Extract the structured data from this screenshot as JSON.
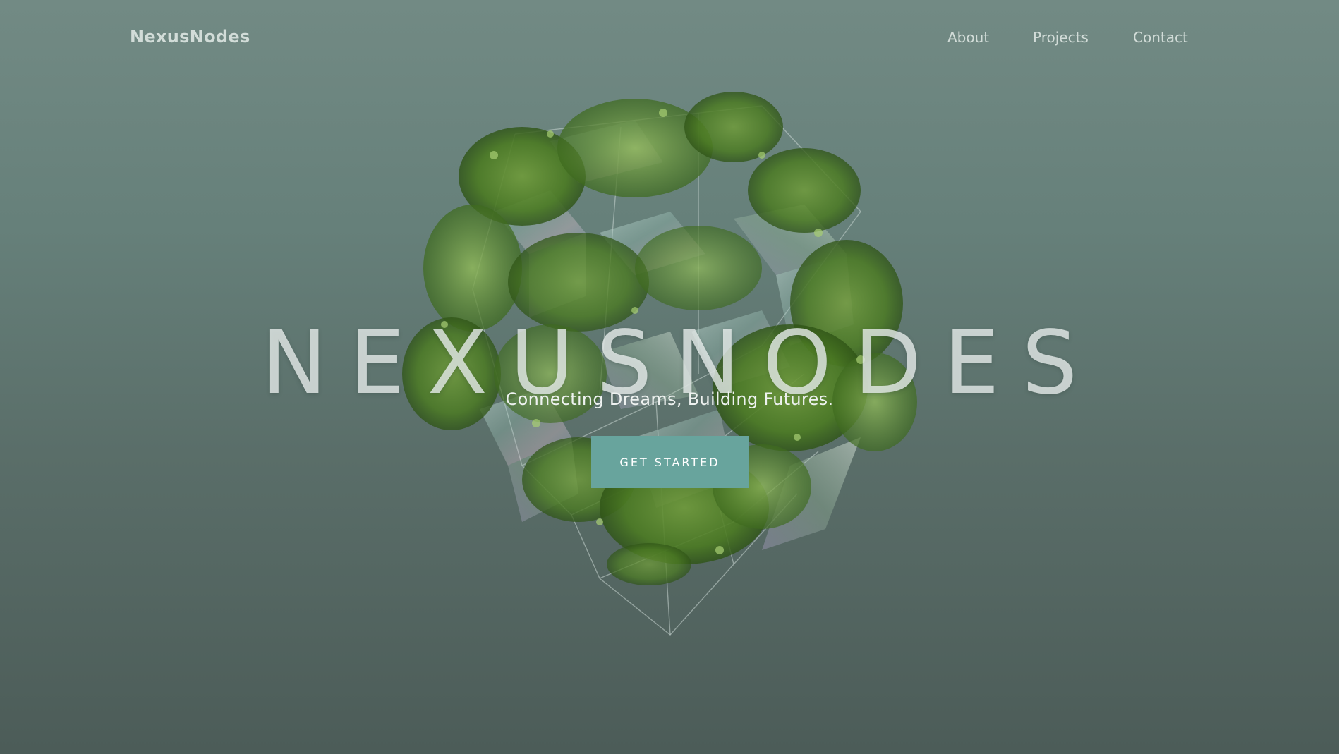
{
  "nav": {
    "brand": "NexusNodes",
    "links": [
      {
        "label": "About"
      },
      {
        "label": "Projects"
      },
      {
        "label": "Contact"
      }
    ]
  },
  "hero": {
    "title": "NEXUSNODES",
    "tagline": "Connecting Dreams, Building Futures.",
    "cta_label": "GET STARTED",
    "image_icon": "foliage-glass-cube-illustration"
  },
  "colors": {
    "background_top": "#728a84",
    "background_bottom": "#4c5c58",
    "accent": "#68a49d",
    "nav_text": "#d2dcd8",
    "foliage": "#4f7d2a"
  }
}
